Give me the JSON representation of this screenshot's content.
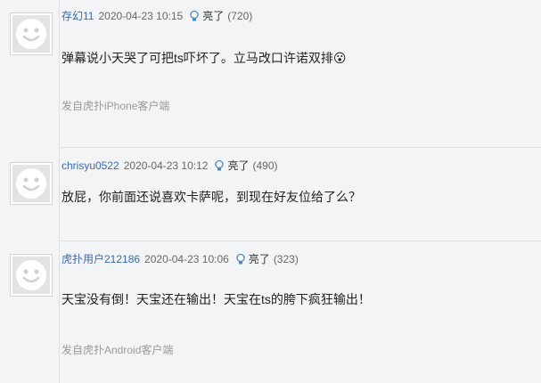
{
  "comments": [
    {
      "username": "存幻11",
      "time": "2020-04-23 10:15",
      "light_label": "亮了",
      "light_count": "(720)",
      "content": "弹幕说小天哭了可把ts吓坏了。立马改口许诺双排😮",
      "source": "发自虎扑iPhone客户端"
    },
    {
      "username": "chrisyu0522",
      "time": "2020-04-23 10:12",
      "light_label": "亮了",
      "light_count": "(490)",
      "content": "放屁，你前面还说喜欢卡萨呢，到现在好友位给了么？",
      "source": ""
    },
    {
      "username": "虎扑用户212186",
      "time": "2020-04-23 10:06",
      "light_label": "亮了",
      "light_count": "(323)",
      "content": "天宝没有倒！天宝还在输出！天宝在ts的胯下疯狂输出！",
      "source": "发自虎扑Android客户端"
    }
  ]
}
